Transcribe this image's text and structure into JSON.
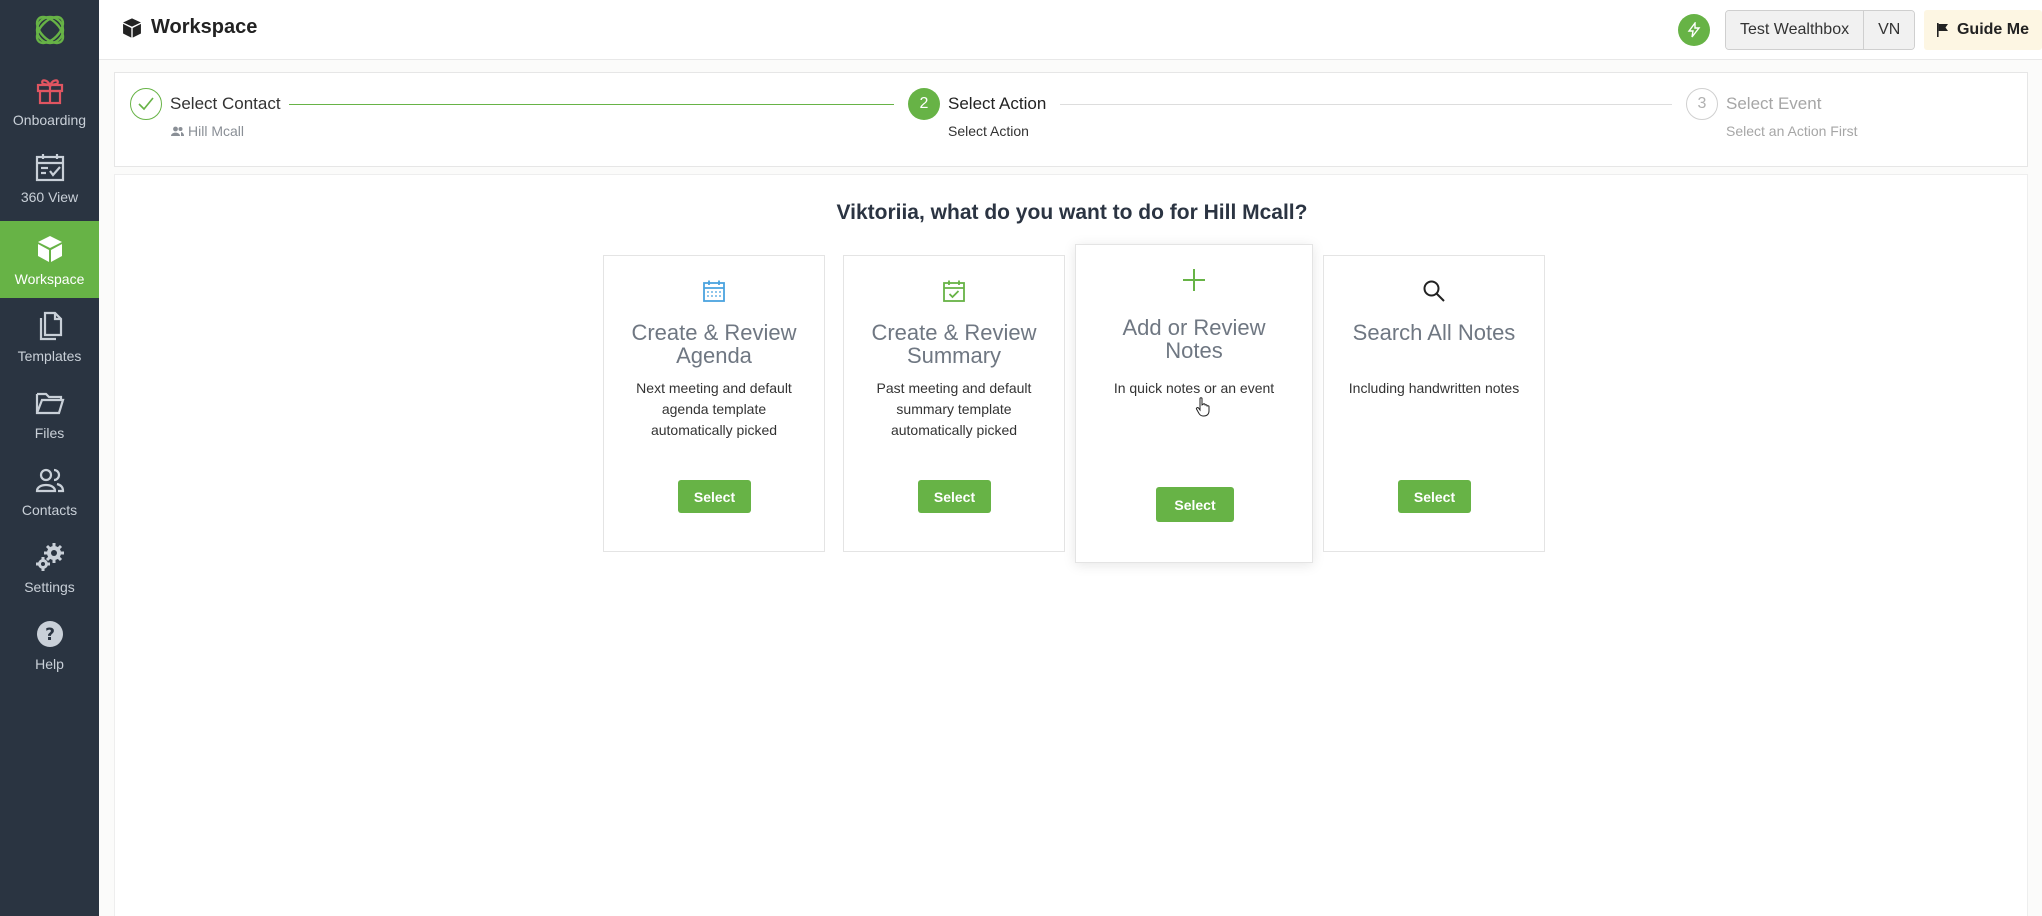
{
  "sidebar": {
    "items": [
      {
        "label": "Onboarding",
        "icon": "gift-icon"
      },
      {
        "label": "360 View",
        "icon": "calendar-check-icon"
      },
      {
        "label": "Workspace",
        "icon": "cube-icon",
        "active": true
      },
      {
        "label": "Templates",
        "icon": "copy-icon"
      },
      {
        "label": "Files",
        "icon": "folder-icon"
      },
      {
        "label": "Contacts",
        "icon": "users-icon"
      },
      {
        "label": "Settings",
        "icon": "gears-icon"
      },
      {
        "label": "Help",
        "icon": "help-icon"
      }
    ]
  },
  "header": {
    "title": "Workspace",
    "integration": "Test Wealthbox",
    "user_initials": "VN",
    "guide_label": "Guide Me"
  },
  "stepper": {
    "steps": [
      {
        "number": "1",
        "title": "Select Contact",
        "subtitle": "Hill Mcall",
        "state": "done"
      },
      {
        "number": "2",
        "title": "Select Action",
        "subtitle": "Select Action",
        "state": "active"
      },
      {
        "number": "3",
        "title": "Select Event",
        "subtitle": "Select an Action First",
        "state": "pending"
      }
    ]
  },
  "main": {
    "question": "Viktoriia, what do you want to do for Hill Mcall?",
    "cards": [
      {
        "title": "Create & Review Agenda",
        "description": "Next meeting and default agenda template automatically picked",
        "button": "Select",
        "icon": "calendar-icon"
      },
      {
        "title": "Create & Review Summary",
        "description": "Past meeting and default summary template automatically picked",
        "button": "Select",
        "icon": "calendar-check-icon"
      },
      {
        "title": "Add or Review Notes",
        "description": "In quick notes or an event",
        "button": "Select",
        "icon": "plus-icon"
      },
      {
        "title": "Search All Notes",
        "description": "Including handwritten notes",
        "button": "Select",
        "icon": "search-icon"
      }
    ]
  },
  "colors": {
    "accent": "#67b346",
    "sidebar_bg": "#2a3441",
    "agenda_icon": "#4aa3df"
  }
}
